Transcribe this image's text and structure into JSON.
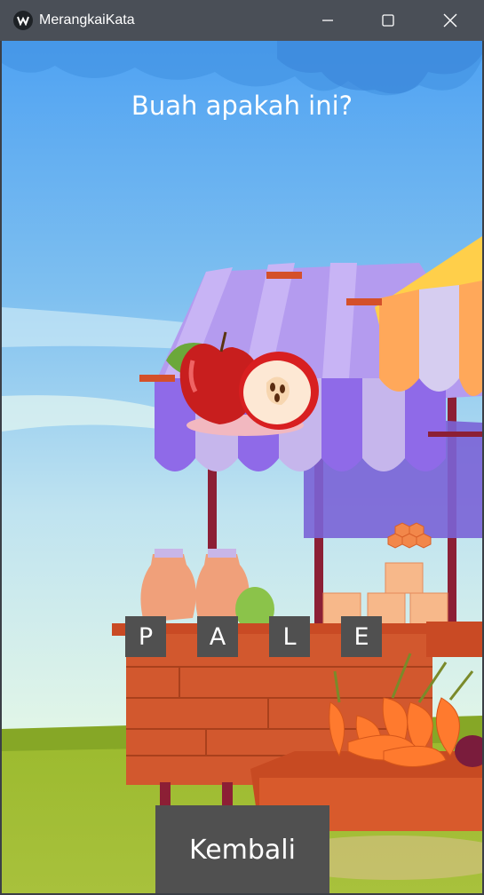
{
  "window": {
    "title": "MerangkaiKata"
  },
  "game": {
    "question": "Buah apakah ini?",
    "letters": [
      "P",
      "A",
      "L",
      "E"
    ],
    "back_label": "Kembali"
  },
  "icons": [
    "app-logo-icon",
    "minimize-icon",
    "maximize-icon",
    "close-icon",
    "apple-icon"
  ],
  "colors": {
    "titlebar": "#4a4f57",
    "tile": "#505050",
    "sky": "#5aa9f0"
  }
}
